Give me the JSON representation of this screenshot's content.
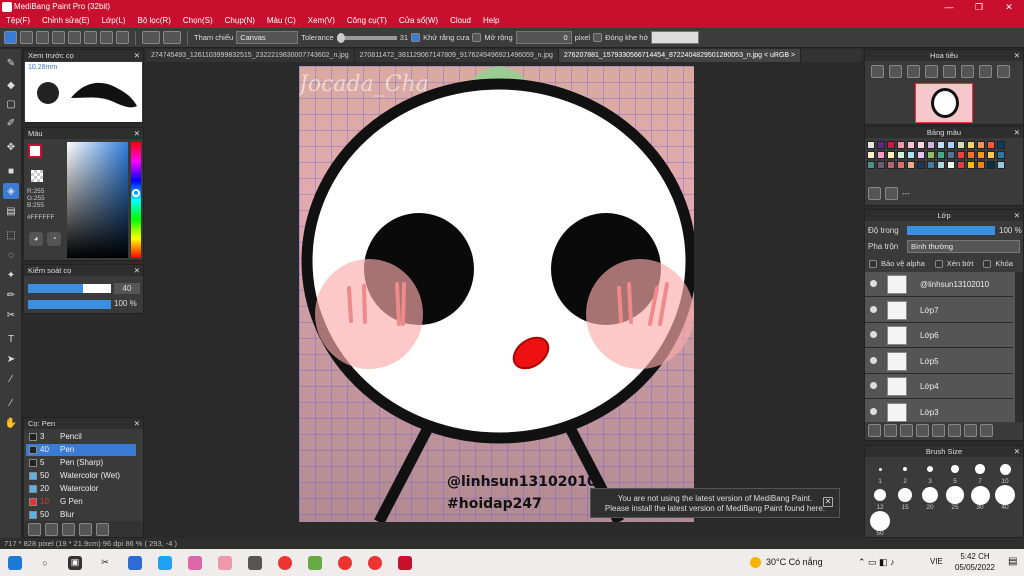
{
  "window": {
    "title": "MediBang Paint Pro (32bit)"
  },
  "menu": [
    "Tệp(F)",
    "Chỉnh sửa(E)",
    "Lớp(L)",
    "Bộ lọc(R)",
    "Chọn(S)",
    "Chụp(N)",
    "Màu (C)",
    "Xem(V)",
    "Công cụ(T)",
    "Cửa sổ(W)",
    "Cloud",
    "Help"
  ],
  "toolbar": {
    "reference_label": "Tham chiếu",
    "reference_value": "Canvas",
    "tolerance_label": "Tolerance",
    "tolerance_value": "31",
    "antialias_label": "Khử răng cưa",
    "expand_label": "Mở rộng",
    "expand_value": "0",
    "expand_unit": "pixel",
    "close_gap_label": "Đóng khe hở"
  },
  "tabs": [
    "274745493_1261103999832515_2322219830007743602_n.jpg",
    "270811472_381129067147809_9176249496921496059_n.jpg",
    "276207881_1579330566714454_8722404829501280053_n.jpg < uRGB >"
  ],
  "preview_panel": {
    "title": "Xem trước cọ",
    "size": "10.28mm"
  },
  "color_panel": {
    "title": "Màu",
    "r": "R:255",
    "g": "G:255",
    "b": "B:255",
    "hex": "#FFFFFF"
  },
  "brush_control": {
    "title": "Kiểm soát cọ",
    "size_value": "40",
    "opacity_value": "100 %",
    "size_fraction": 0.66,
    "opacity_fraction": 1.0
  },
  "brush_panel": {
    "title": "Cọ: Pen",
    "items": [
      {
        "size": "3",
        "name": "Pencil",
        "color": "#222222"
      },
      {
        "size": "40",
        "name": "Pen",
        "color": "#222222"
      },
      {
        "size": "5",
        "name": "Pen (Sharp)",
        "color": "#222222"
      },
      {
        "size": "50",
        "name": "Watercolor (Wet)",
        "color": "#5ab4e6"
      },
      {
        "size": "20",
        "name": "Watercolor",
        "color": "#5ab4e6"
      },
      {
        "size": "10",
        "name": "G Pen",
        "color": "#e63232"
      },
      {
        "size": "50",
        "name": "Blur",
        "color": "#5ab4e6"
      }
    ]
  },
  "navigator": {
    "title": "Hoa tiêu"
  },
  "palette": {
    "title": "Bảng màu",
    "label": "---"
  },
  "layers": {
    "title": "Lớp",
    "opacity_label": "Độ trong",
    "opacity_value": "100 %",
    "opacity_fraction": 1.0,
    "blend_label": "Pha trộn",
    "blend_value": "Bình thường",
    "protect_alpha": "Bảo vệ alpha",
    "clipping": "Xén bớt",
    "lock": "Khóa",
    "items": [
      "@linhsun13102010",
      "Lớp7",
      "Lớp6",
      "Lớp5",
      "Lớp4",
      "Lớp3"
    ]
  },
  "brush_size": {
    "title": "Brush Size",
    "values": [
      "1",
      "2",
      "3",
      "5",
      "7",
      "10",
      "12",
      "15",
      "20",
      "25",
      "30",
      "40",
      "50"
    ]
  },
  "canvas_text": {
    "handle": "@linhsun13102010",
    "tag": "#hoidap247",
    "watermark": "Jocada_Cha"
  },
  "notification": {
    "line1": "You are not using the latest version of MediBang Paint.",
    "line2": "Please install the latest version of MediBang Paint found here."
  },
  "status": {
    "text": "717 * 828 pixel  (19 * 21.9cm)  96 dpi  86 %  ( 293, -4 )"
  },
  "taskbar": {
    "weather": "30°C  Có nắng",
    "lang": "VIE",
    "time": "5:42 CH",
    "date": "05/05/2022"
  },
  "colors": {
    "accent": "#c8102e",
    "selection": "#3a7bd5"
  }
}
